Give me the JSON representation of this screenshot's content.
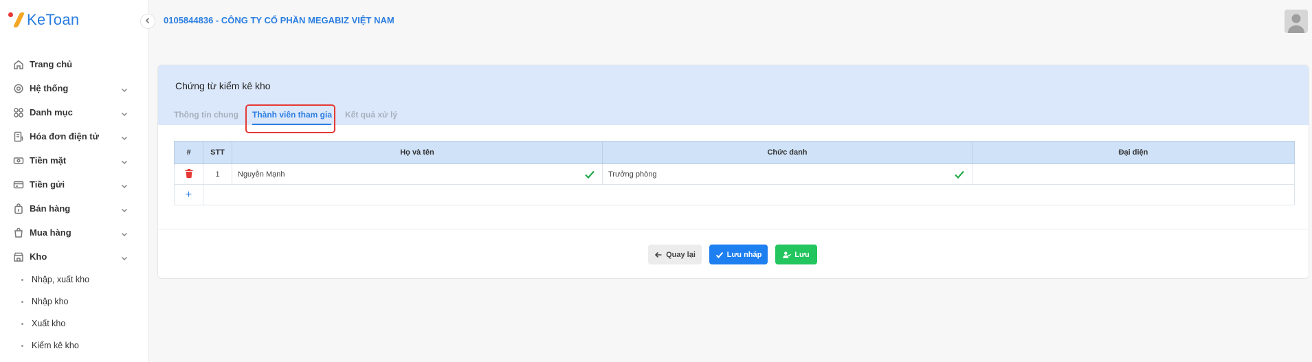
{
  "brand": {
    "name": "KeToan"
  },
  "header": {
    "company": "0105844836 - CÔNG TY CỔ PHẦN MEGABIZ VIỆT NAM"
  },
  "sidebar": {
    "items": [
      {
        "label": "Trang chủ",
        "icon": "home-icon",
        "has_children": false
      },
      {
        "label": "Hệ thống",
        "icon": "gear-icon",
        "has_children": true
      },
      {
        "label": "Danh mục",
        "icon": "grid-icon",
        "has_children": true
      },
      {
        "label": "Hóa đơn điện tử",
        "icon": "invoice-icon",
        "has_children": true
      },
      {
        "label": "Tiền mặt",
        "icon": "cash-icon",
        "has_children": true
      },
      {
        "label": "Tiền gửi",
        "icon": "card-icon",
        "has_children": true
      },
      {
        "label": "Bán hàng",
        "icon": "bag-icon",
        "has_children": true
      },
      {
        "label": "Mua hàng",
        "icon": "cart-icon",
        "has_children": true
      },
      {
        "label": "Kho",
        "icon": "warehouse-icon",
        "has_children": true,
        "expanded": true
      }
    ],
    "kho_sub": [
      "Nhập, xuất kho",
      "Nhập kho",
      "Xuất kho",
      "Kiểm kê kho"
    ]
  },
  "card": {
    "title": "Chứng từ kiểm kê kho",
    "tabs": [
      "Thông tin chung",
      "Thành viên tham gia",
      "Kết quả xử lý"
    ],
    "active_tab": "Thành viên tham gia"
  },
  "table": {
    "headers": [
      "#",
      "STT",
      "Họ và tên",
      "Chức danh",
      "Đại diện"
    ],
    "rows": [
      {
        "stt": "1",
        "name": "Nguyễn Mạnh",
        "title": "Trưởng phòng",
        "representative": ""
      }
    ],
    "add_label": "+"
  },
  "buttons": {
    "back": "Quay lại",
    "draft": "Lưu nháp",
    "save": "Lưu"
  },
  "colors": {
    "accent": "#2a7de1",
    "header_bg": "#dbe8fb",
    "table_header_bg": "#cfe2f8",
    "success": "#22c55e",
    "danger": "#e53935"
  }
}
